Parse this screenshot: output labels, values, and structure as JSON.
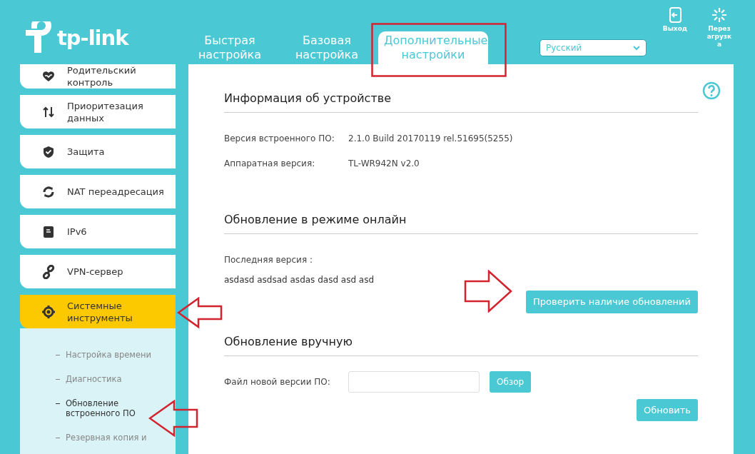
{
  "header": {
    "logo": "tp-link",
    "tabs": [
      {
        "label": "Быстрая настройка",
        "selected": false
      },
      {
        "label": "Базовая настройка",
        "selected": false
      },
      {
        "label": "Дополнительные настройки",
        "selected": true
      }
    ],
    "language": {
      "value": "Русский"
    },
    "actions": [
      {
        "kind": "logout",
        "label": "Выход"
      },
      {
        "kind": "reboot",
        "label": "Перезагрузка"
      }
    ]
  },
  "sidebar": {
    "items": [
      {
        "kind": "parental",
        "label": "Родительский контроль",
        "selected": false
      },
      {
        "kind": "qos",
        "label": "Приоритезация данных",
        "selected": false
      },
      {
        "kind": "security",
        "label": "Защита",
        "selected": false
      },
      {
        "kind": "nat",
        "label": "NAT переадресация",
        "selected": false
      },
      {
        "kind": "ipv6",
        "label": "IPv6",
        "selected": false
      },
      {
        "kind": "vpn",
        "label": "VPN-сервер",
        "selected": false
      },
      {
        "kind": "system",
        "label": "Системные инструменты",
        "selected": true,
        "children": [
          {
            "label": "Настройка времени",
            "selected": false
          },
          {
            "label": "Диагностика",
            "selected": false
          },
          {
            "label": "Обновление встроенного ПО",
            "selected": true
          },
          {
            "label": "Резервная копия и",
            "selected": false
          }
        ]
      }
    ]
  },
  "content": {
    "sections": [
      {
        "title": "Информация об устройстве",
        "rows": [
          {
            "label": "Версия встроенного ПО:",
            "value": "2.1.0 Build 20170119 rel.51695(5255)"
          },
          {
            "label": "Аппаратная версия:",
            "value": "TL-WR942N v2.0"
          }
        ]
      },
      {
        "title": "Обновление в режиме онлайн",
        "rows": [
          {
            "label": "Последняя версия :"
          }
        ],
        "note": "asdasd asdsad asdas dasd asd asd",
        "button": "Проверить наличие обновлений"
      },
      {
        "title": "Обновление вручную",
        "file_field": {
          "label": "Файл новой версии ПО:",
          "browse": "Обзор"
        },
        "button": "Обновить"
      }
    ]
  }
}
